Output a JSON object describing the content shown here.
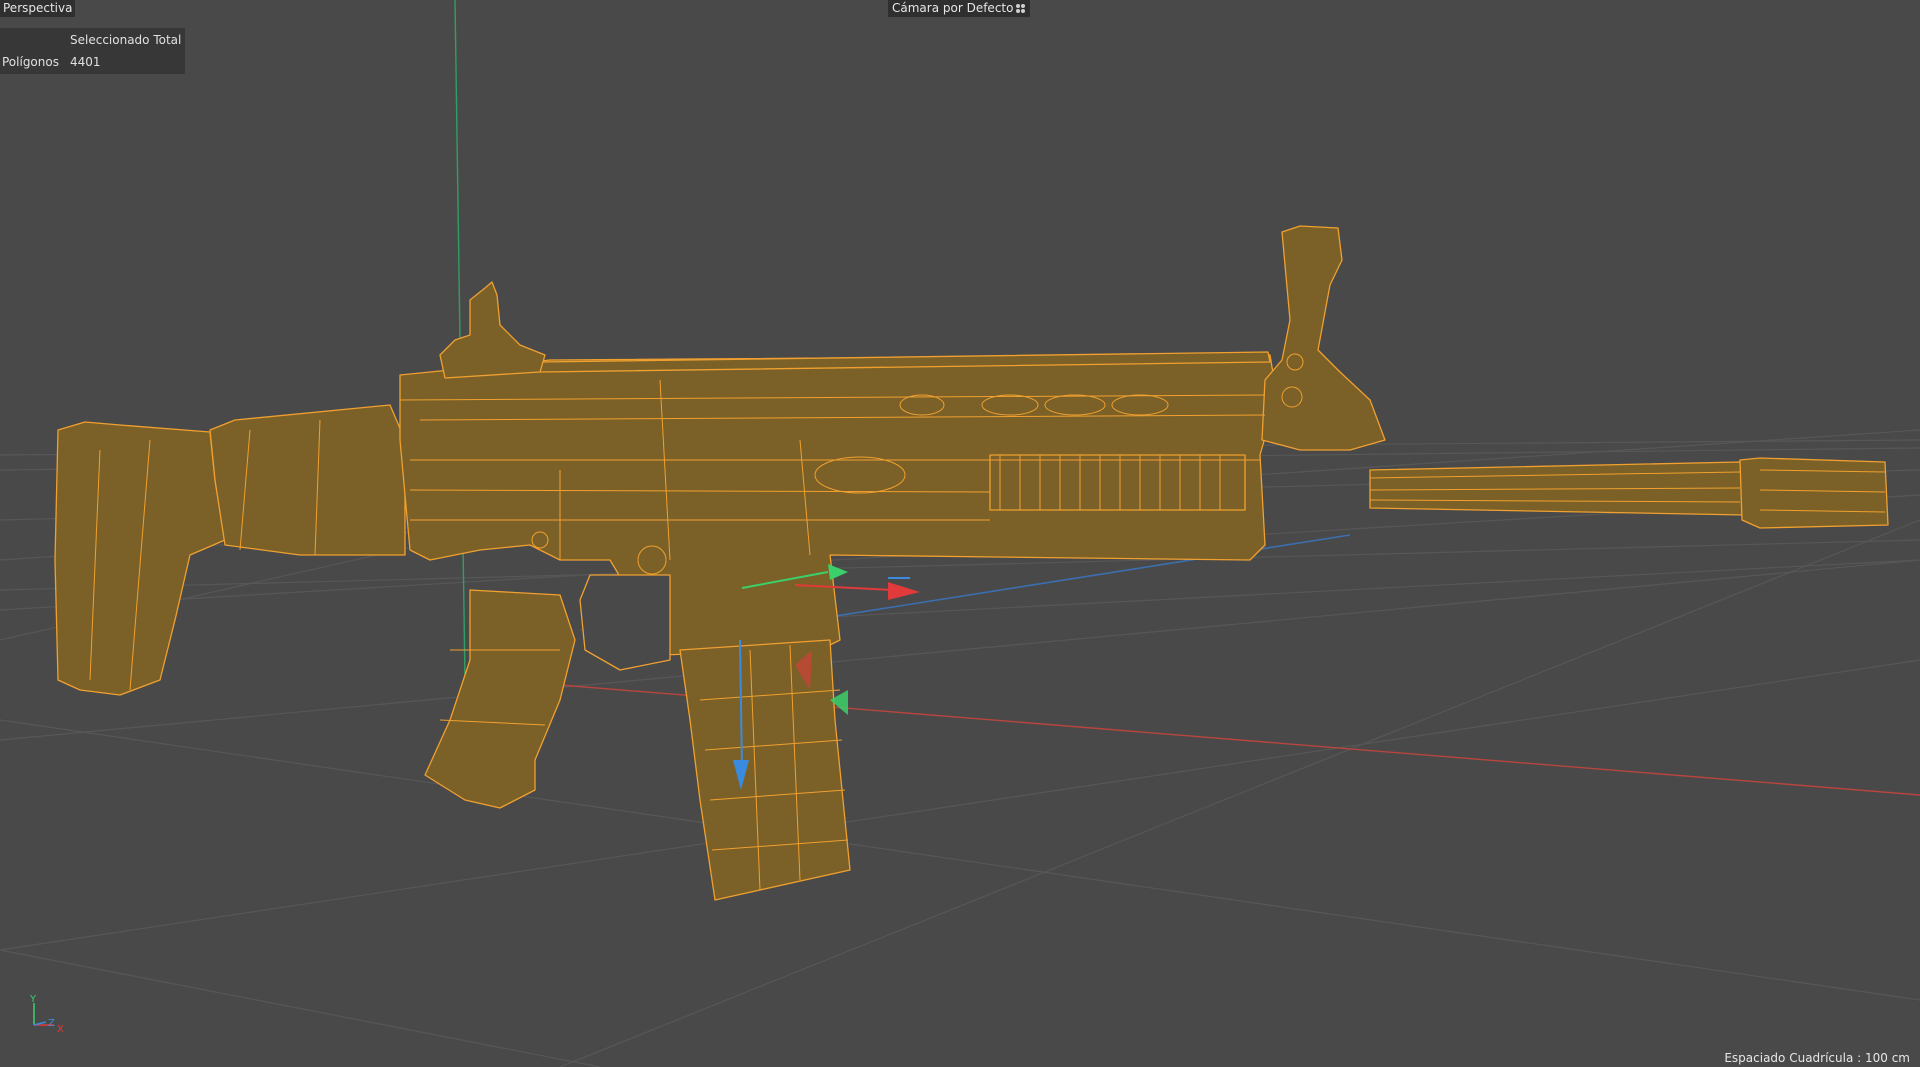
{
  "viewport": {
    "projection_label": "Perspectiva",
    "camera_label": "Cámara por Defecto",
    "camera_icon": "camera-dots-icon",
    "grid_spacing_label": "Espaciado Cuadrícula : 100 cm"
  },
  "info_panel": {
    "header": "Seleccionado Total",
    "polygons_label": "Polígonos",
    "polygons_value": "4401"
  },
  "axis_gizmo": {
    "y_label": "Y",
    "z_label": "Z",
    "x_label": "X"
  },
  "model": {
    "description_icon": "wireframe-rifle-model"
  },
  "colors": {
    "background": "#494949",
    "selection_wire": "#f0a030",
    "model_fill": "#7b6127",
    "axis_x": "#e03a3a",
    "axis_y": "#3bd06a",
    "axis_z": "#3a8be0"
  }
}
